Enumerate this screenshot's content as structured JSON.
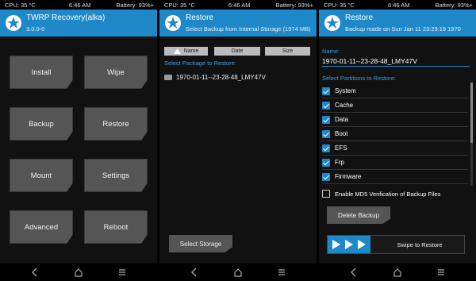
{
  "status": {
    "cpu": "CPU: 35 °C",
    "time": "6:46 AM",
    "battery": "Battery: 93%+"
  },
  "colors": {
    "accent": "#1e88c8",
    "button": "#555555",
    "background": "#111111"
  },
  "main": {
    "title": "TWRP Recovery(alka)",
    "version": "3.0.0-0",
    "buttons": {
      "install": "Install",
      "wipe": "Wipe",
      "backup": "Backup",
      "restore": "Restore",
      "mount": "Mount",
      "settings": "Settings",
      "advanced": "Advanced",
      "reboot": "Reboot"
    }
  },
  "restore_select": {
    "title": "Restore",
    "subtitle": "Select Backup from Internal Storage (1974 MB)",
    "sort": {
      "name": "Name",
      "date": "Date",
      "size": "Size"
    },
    "package_label": "Select Package to Restore:",
    "packages": [
      "1970-01-11--23-28-48_LMY47V"
    ],
    "select_storage": "Select Storage"
  },
  "restore_detail": {
    "title": "Restore",
    "subtitle": "Backup made on Sun Jan 11 23:29:19 1970",
    "name_label": "Name:",
    "name_value": "1970-01-11--23-28-48_LMY47V",
    "partitions_label": "Select Partitions to Restore:",
    "partitions": [
      "System",
      "Cache",
      "Data",
      "Boot",
      "EFS",
      "Frp",
      "Firmware"
    ],
    "md5_label": "Enable MD5 Verification of Backup Files",
    "md5_checked": false,
    "delete_backup": "Delete Backup",
    "swipe_label": "Swipe to Restore"
  },
  "nav_icons": [
    "back-icon",
    "home-icon",
    "menu-icon"
  ]
}
